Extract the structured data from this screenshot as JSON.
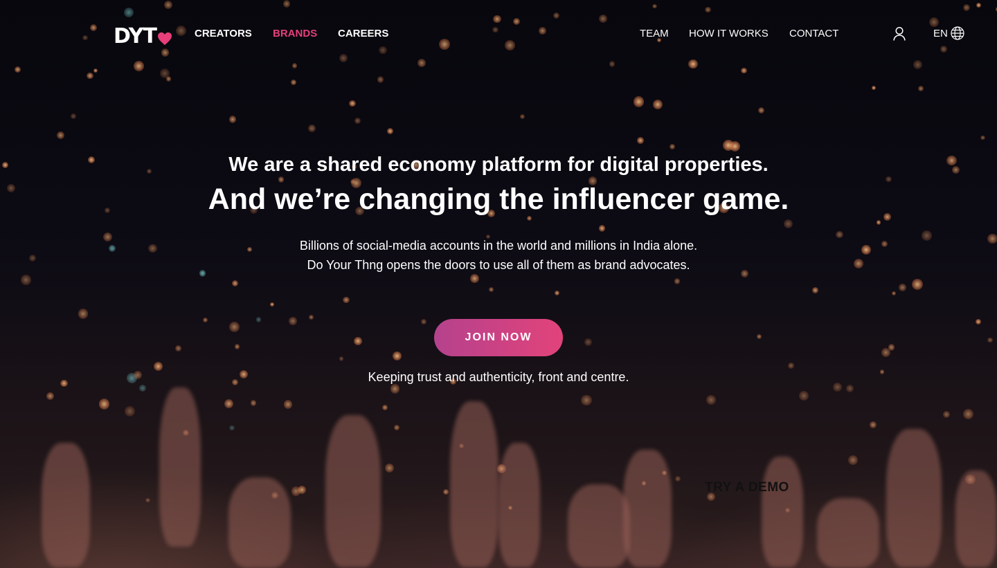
{
  "brand": {
    "logo_text": "DYT",
    "accent_color": "#e63f7a"
  },
  "nav": {
    "left_links": [
      {
        "label": "CREATORS",
        "active": false
      },
      {
        "label": "BRANDS",
        "active": true
      },
      {
        "label": "CAREERS",
        "active": false
      }
    ],
    "right_links": [
      {
        "label": "TEAM"
      },
      {
        "label": "HOW IT WORKS"
      },
      {
        "label": "CONTACT"
      }
    ],
    "user_icon": "user-icon",
    "language": {
      "label": "EN",
      "icon": "globe-icon"
    }
  },
  "hero": {
    "headline_line1": "We are a shared economy platform for digital properties.",
    "headline_line2": "And we’re changing the influencer game.",
    "subtext_line1": "Billions of social-media accounts in the world and millions in India alone.",
    "subtext_line2": "Do Your Thng opens the doors to use all of them as brand advocates.",
    "cta_label": "JOIN NOW",
    "tagline": "Keeping trust and authenticity, front and centre.",
    "demo_label": "TRY A DEMO"
  }
}
